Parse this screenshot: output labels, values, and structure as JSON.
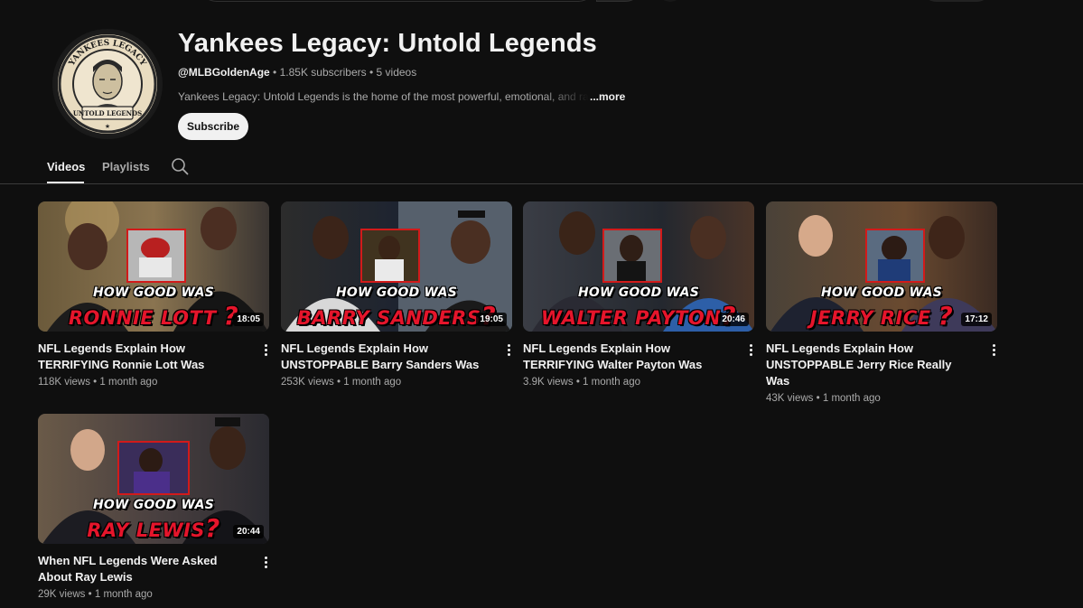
{
  "channel": {
    "name": "Yankees Legacy: Untold Legends",
    "handle": "@MLBGoldenAge",
    "subscribers": "1.85K subscribers",
    "video_count": "5 videos",
    "description": "Yankees Legacy: Untold Legends is the home of the most powerful, emotional, and rarely",
    "more_label": "...more",
    "subscribe_label": "Subscribe",
    "logo_text_top": "YANKEES LEGACY",
    "logo_text_bottom": "UNTOLD LEGENDS"
  },
  "tabs": [
    {
      "label": "Videos",
      "active": true
    },
    {
      "label": "Playlists",
      "active": false
    }
  ],
  "videos": [
    {
      "title": "NFL Legends Explain How TERRIFYING Ronnie Lott Was",
      "views": "118K views",
      "age": "1 month ago",
      "duration": "18:05",
      "thumb_line1": "HOW GOOD WAS",
      "thumb_line2": "RONNIE LOTT"
    },
    {
      "title": "NFL Legends Explain How UNSTOPPABLE Barry Sanders Was",
      "views": "253K views",
      "age": "1 month ago",
      "duration": "19:05",
      "thumb_line1": "HOW GOOD WAS",
      "thumb_line2": "BARRY SANDERS"
    },
    {
      "title": "NFL Legends Explain How TERRIFYING Walter Payton Was",
      "views": "3.9K views",
      "age": "1 month ago",
      "duration": "20:46",
      "thumb_line1": "HOW GOOD WAS",
      "thumb_line2": "WALTER PAYTON"
    },
    {
      "title": "NFL Legends Explain How UNSTOPPABLE Jerry Rice Really Was",
      "views": "43K views",
      "age": "1 month ago",
      "duration": "17:12",
      "thumb_line1": "HOW GOOD WAS",
      "thumb_line2": "JERRY RICE"
    },
    {
      "title": "When NFL Legends Were Asked About Ray Lewis",
      "views": "29K views",
      "age": "1 month ago",
      "duration": "20:44",
      "thumb_line1": "HOW GOOD WAS",
      "thumb_line2": "RAY LEWIS"
    }
  ],
  "meta_separator": "•",
  "thumb_question_mark": "?",
  "colors": {
    "background": "#0f0f0f",
    "accent_red": "#e5152b",
    "text_primary": "#f1f1f1",
    "text_secondary": "#aaaaaa"
  }
}
